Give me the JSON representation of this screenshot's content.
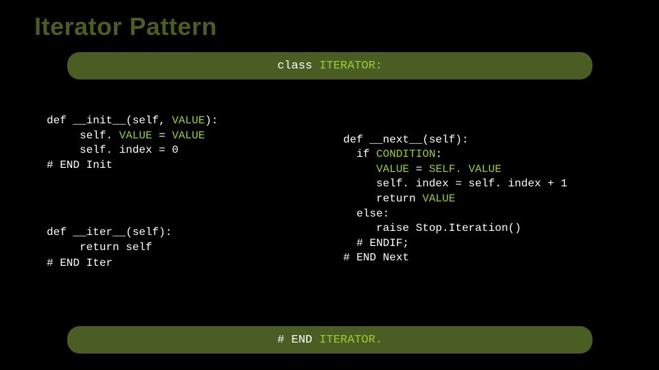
{
  "title": "Iterator Pattern",
  "classHeader": {
    "kw": "class ",
    "name": "ITERATOR:"
  },
  "init": {
    "l1a": "def __init__(self, ",
    "l1b": "VALUE",
    "l1c": "):",
    "l2a": "     self. ",
    "l2b": "VALUE",
    "l2c": " = ",
    "l2d": "VALUE",
    "l3": "     self. index = 0",
    "l4": "# END Init"
  },
  "iter": {
    "l1": "def __iter__(self):",
    "l2": "     return self",
    "l3": "# END Iter"
  },
  "next": {
    "l1": "def __next__(self):",
    "l2a": "  if ",
    "l2b": "CONDITION",
    "l2c": ":",
    "l3a": "     ",
    "l3b": "VALUE",
    "l3c": " = ",
    "l3d": "SELF. VALUE",
    "l4": "     self. index = self. index + 1",
    "l5a": "     return ",
    "l5b": "VALUE",
    "l6": "  else:",
    "l7": "     raise Stop.Iteration()",
    "l8": "  # ENDIF;",
    "l9": "# END Next"
  },
  "footer": {
    "a": "# END ",
    "b": "ITERATOR."
  }
}
